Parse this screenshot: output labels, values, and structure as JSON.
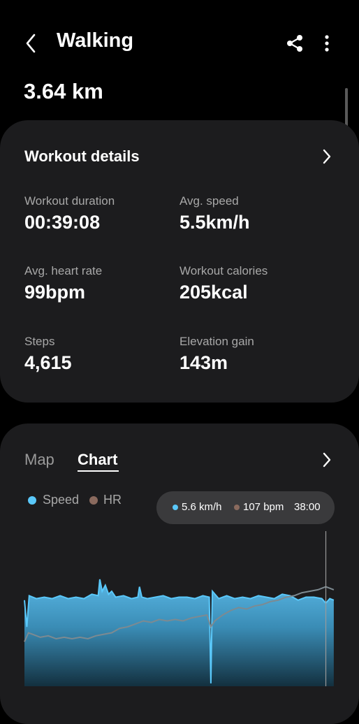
{
  "header": {
    "title": "Walking"
  },
  "summary": {
    "distance": "3.64 km"
  },
  "workout": {
    "title": "Workout details",
    "duration_label": "Workout duration",
    "duration_value": "00:39:08",
    "speed_label": "Avg. speed",
    "speed_value": "5.5km/h",
    "hr_label": "Avg. heart rate",
    "hr_value": "99bpm",
    "calories_label": "Workout calories",
    "calories_value": "205kcal",
    "steps_label": "Steps",
    "steps_value": "4,615",
    "elevation_label": "Elevation gain",
    "elevation_value": "143m"
  },
  "tabs": {
    "map": "Map",
    "chart": "Chart",
    "active": "Chart"
  },
  "legend": {
    "speed": "Speed",
    "hr": "HR",
    "speed_color": "#5ac8fa",
    "hr_color": "#8a6a5e"
  },
  "tooltip": {
    "speed": "5.6 km/h",
    "hr": "107 bpm",
    "time": "38:00"
  },
  "icons": {
    "back": "chevron-left-icon",
    "share": "share-icon",
    "more": "more-vertical-icon",
    "details": "chevron-right-icon"
  },
  "chart_data": {
    "type": "area",
    "x_unit": "minutes",
    "x_range": [
      0,
      39.1
    ],
    "speed_series": [
      [
        0,
        5.8
      ],
      [
        0.3,
        4.0
      ],
      [
        0.6,
        6.1
      ],
      [
        1.5,
        5.9
      ],
      [
        2.5,
        6.0
      ],
      [
        3.5,
        5.9
      ],
      [
        4.5,
        6.1
      ],
      [
        5.5,
        5.9
      ],
      [
        6.5,
        6.0
      ],
      [
        7.5,
        5.9
      ],
      [
        8.5,
        6.2
      ],
      [
        9.3,
        6.1
      ],
      [
        9.5,
        7.2
      ],
      [
        9.8,
        6.4
      ],
      [
        10.2,
        6.8
      ],
      [
        10.6,
        6.2
      ],
      [
        11.0,
        6.4
      ],
      [
        11.5,
        6.0
      ],
      [
        12.5,
        6.1
      ],
      [
        13.5,
        5.9
      ],
      [
        14.3,
        6.0
      ],
      [
        14.5,
        6.7
      ],
      [
        14.8,
        6.0
      ],
      [
        15.5,
        5.9
      ],
      [
        16.5,
        6.0
      ],
      [
        17.5,
        6.1
      ],
      [
        18.5,
        5.9
      ],
      [
        19.5,
        6.0
      ],
      [
        20.5,
        6.0
      ],
      [
        21.5,
        5.9
      ],
      [
        22.5,
        6.1
      ],
      [
        23.3,
        6.0
      ],
      [
        23.5,
        0.2
      ],
      [
        23.7,
        6.4
      ],
      [
        24.5,
        5.9
      ],
      [
        25.5,
        6.1
      ],
      [
        26.5,
        5.9
      ],
      [
        27.5,
        6.0
      ],
      [
        28.5,
        5.9
      ],
      [
        29.5,
        6.1
      ],
      [
        30.5,
        6.0
      ],
      [
        31.5,
        5.9
      ],
      [
        32.5,
        6.2
      ],
      [
        33.5,
        6.1
      ],
      [
        34.5,
        5.8
      ],
      [
        35.5,
        6.0
      ],
      [
        36.5,
        6.0
      ],
      [
        37.5,
        5.9
      ],
      [
        38.0,
        5.6
      ],
      [
        38.5,
        5.9
      ],
      [
        39.0,
        5.8
      ]
    ],
    "hr_series": [
      [
        0,
        70
      ],
      [
        0.5,
        76
      ],
      [
        1,
        75
      ],
      [
        2,
        73
      ],
      [
        3,
        74
      ],
      [
        4,
        72
      ],
      [
        5,
        73
      ],
      [
        6,
        72
      ],
      [
        7,
        73
      ],
      [
        8,
        72
      ],
      [
        9,
        74
      ],
      [
        10,
        75
      ],
      [
        11,
        76
      ],
      [
        12,
        79
      ],
      [
        13,
        80
      ],
      [
        14,
        82
      ],
      [
        15,
        84
      ],
      [
        16,
        83
      ],
      [
        17,
        85
      ],
      [
        18,
        84
      ],
      [
        19,
        85
      ],
      [
        20,
        84
      ],
      [
        21,
        86
      ],
      [
        22,
        87
      ],
      [
        23,
        88
      ],
      [
        23.5,
        80
      ],
      [
        24,
        84
      ],
      [
        25,
        88
      ],
      [
        26,
        91
      ],
      [
        27,
        93
      ],
      [
        28,
        92
      ],
      [
        29,
        94
      ],
      [
        30,
        95
      ],
      [
        31,
        97
      ],
      [
        32,
        98
      ],
      [
        33,
        100
      ],
      [
        34,
        101
      ],
      [
        35,
        103
      ],
      [
        36,
        104
      ],
      [
        37,
        105
      ],
      [
        38,
        107
      ],
      [
        39,
        105
      ]
    ]
  }
}
